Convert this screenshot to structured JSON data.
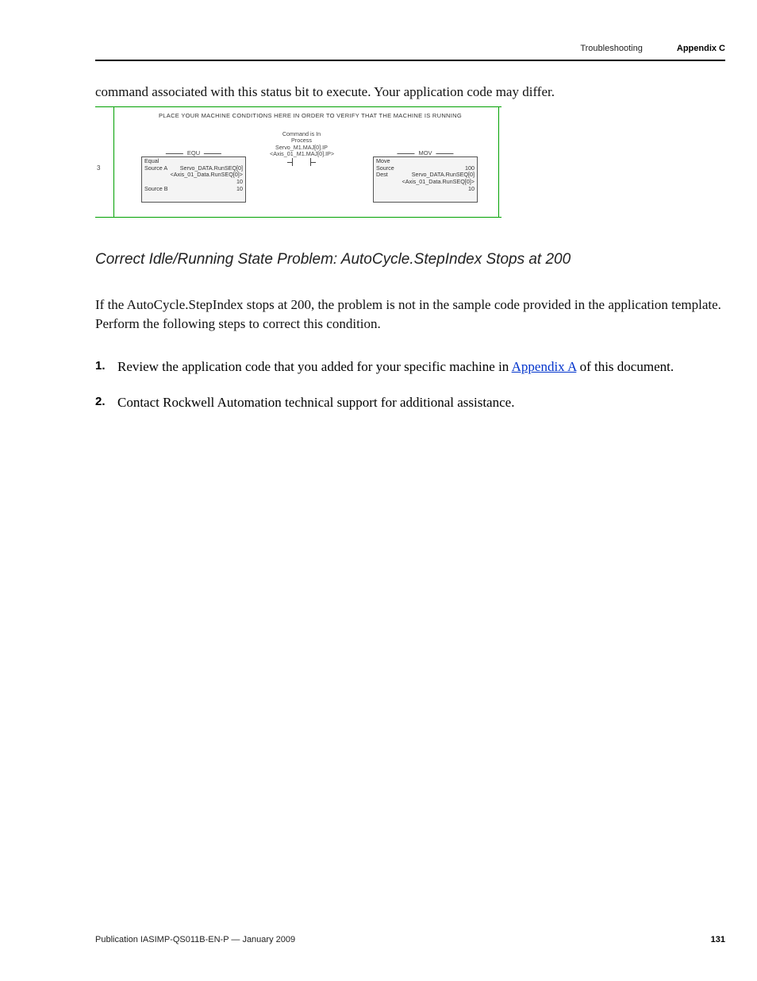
{
  "header": {
    "section": "Troubleshooting",
    "appendix": "Appendix C"
  },
  "intro": "command associated with this status bit to execute. Your application code may differ.",
  "ladder": {
    "caption": "PLACE YOUR MACHINE CONDITIONS HERE IN ORDER TO VERIFY THAT THE MACHINE IS RUNNING",
    "rung_number": "3",
    "command_label": {
      "line1": "Command is In",
      "line2": "Process",
      "line3": "Servo_M1.MAJ[0].IP",
      "line4": "<Axis_01_M1.MAJ[0].IP>"
    },
    "equ_block": {
      "title": "EQU",
      "row1_label": "Equal",
      "row2_label": "Source A",
      "row2_value": "Servo_DATA.RunSEQ[0]",
      "row3_value": "<Axis_01_Data.RunSEQ[0]>",
      "row4_value": "10",
      "row5_label": "Source B",
      "row5_value": "10"
    },
    "mov_block": {
      "title": "MOV",
      "row1_label": "Move",
      "row2_label": "Source",
      "row2_value": "100",
      "row3_label": "Dest",
      "row3_value": "Servo_DATA.RunSEQ[0]",
      "row4_value": "<Axis_01_Data.RunSEQ[0]>",
      "row5_value": "10"
    }
  },
  "section_heading": "Correct Idle/Running State Problem: AutoCycle.StepIndex Stops at 200",
  "section_para": "If the AutoCycle.StepIndex stops at 200, the problem is not in the sample code provided in the application template. Perform the following steps to correct this condition.",
  "steps": {
    "s1_pre": "Review the application code that you added for your specific machine in ",
    "s1_link": "Appendix A",
    "s1_post": " of this document.",
    "s2": "Contact Rockwell Automation technical support for additional assistance."
  },
  "footer": {
    "publication": "Publication IASIMP-QS011B-EN-P — January 2009",
    "page": "131"
  }
}
